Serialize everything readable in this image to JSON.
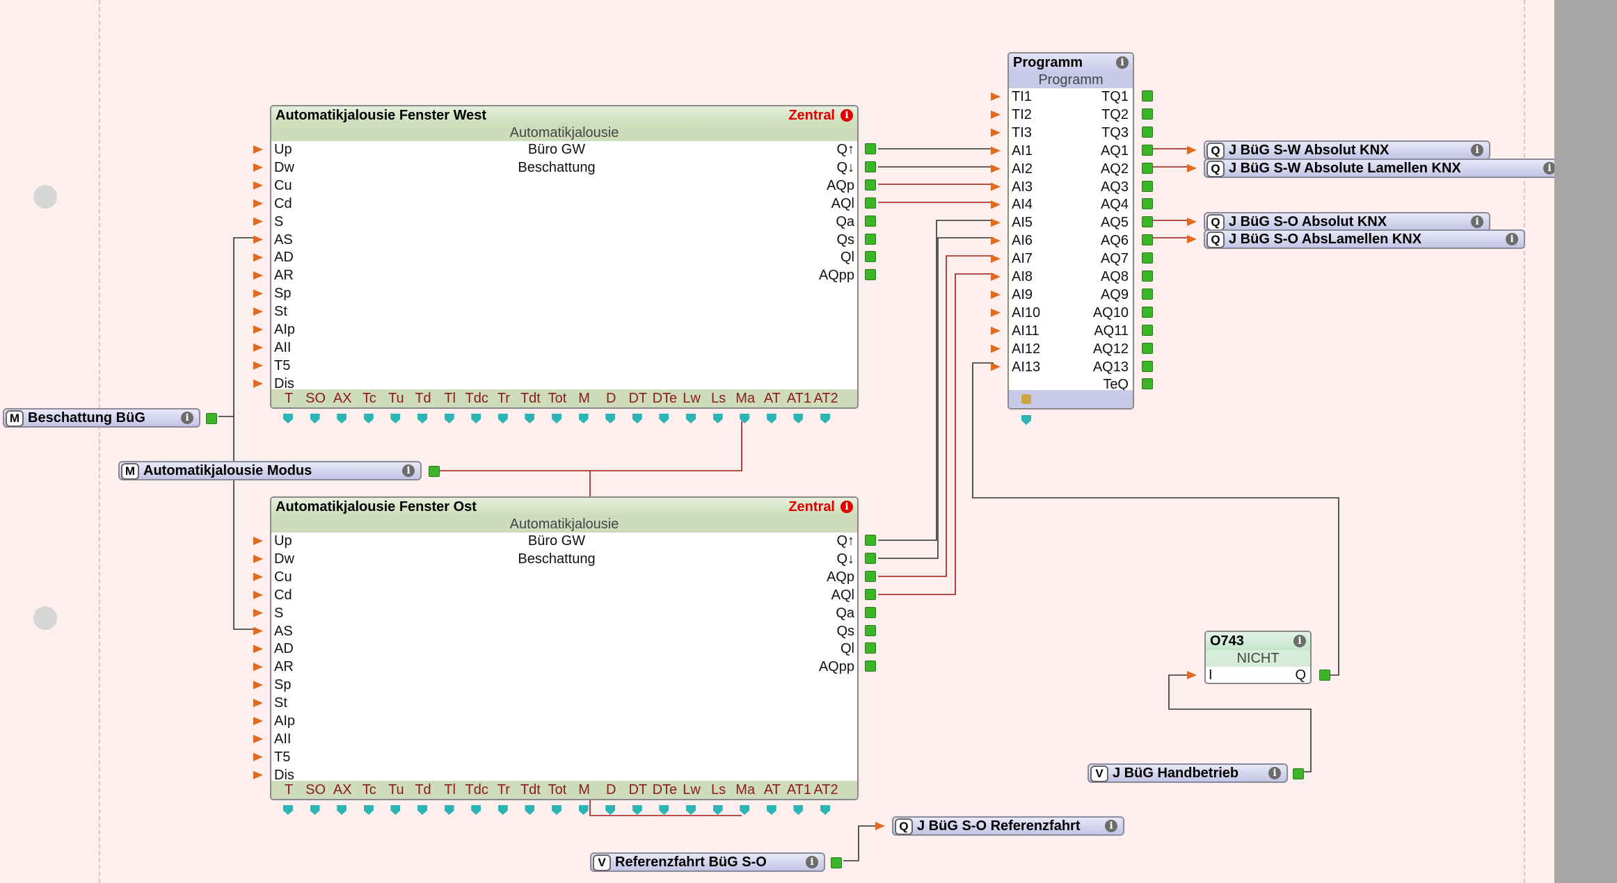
{
  "colors": {
    "background": "#fdefee",
    "wire_red": "#a01818",
    "wire_dark": "#303030",
    "pin_label": "#8b1a1a",
    "zentral": "#e00000"
  },
  "blocks": {
    "west": {
      "title": "Automatikjalousie Fenster West",
      "zentral": "Zentral",
      "subtitle": "Automatikjalousie",
      "comment1": "Büro GW",
      "comment2": "Beschattung"
    },
    "ost": {
      "title": "Automatikjalousie Fenster Ost",
      "zentral": "Zentral",
      "subtitle": "Automatikjalousie",
      "comment1": "Büro GW",
      "comment2": "Beschattung"
    },
    "programm": {
      "title": "Programm",
      "subtitle": "Programm"
    },
    "nicht": {
      "title": "O743",
      "subtitle": "NICHT",
      "input": "I",
      "output": "Q"
    }
  },
  "jal_inputs": [
    "Up",
    "Dw",
    "Cu",
    "Cd",
    "S",
    "AS",
    "AD",
    "AR",
    "Sp",
    "St",
    "AIp",
    "AII",
    "T5",
    "Dis"
  ],
  "jal_outputs": [
    "Q↑",
    "Q↓",
    "AQp",
    "AQl",
    "Qa",
    "Qs",
    "Ql",
    "AQpp"
  ],
  "jal_params": [
    "T",
    "SO",
    "AX",
    "Tc",
    "Tu",
    "Td",
    "Tl",
    "Tdc",
    "Tr",
    "Tdt",
    "Tot",
    "M",
    "D",
    "DT",
    "DTe",
    "Lw",
    "Ls",
    "Ma",
    "AT",
    "AT1",
    "AT2"
  ],
  "prog_inputs": [
    "TI1",
    "TI2",
    "TI3",
    "AI1",
    "AI2",
    "AI3",
    "AI4",
    "AI5",
    "AI6",
    "AI7",
    "AI8",
    "AI9",
    "AI10",
    "AI11",
    "AI12",
    "AI13"
  ],
  "prog_outputs": [
    "TQ1",
    "TQ2",
    "TQ3",
    "AQ1",
    "AQ2",
    "AQ3",
    "AQ4",
    "AQ5",
    "AQ6",
    "AQ7",
    "AQ8",
    "AQ9",
    "AQ10",
    "AQ11",
    "AQ12",
    "AQ13",
    "TeQ"
  ],
  "connectors": [
    {
      "id": "beschattung",
      "badge": "M",
      "label": "Beschattung BüG"
    },
    {
      "id": "modus",
      "badge": "M",
      "label": "Automatikjalousie Modus"
    },
    {
      "id": "sw-absolut",
      "badge": "Q",
      "label": "J BüG S-W Absolut KNX"
    },
    {
      "id": "sw-lamellen",
      "badge": "Q",
      "label": "J BüG S-W Absolute Lamellen KNX"
    },
    {
      "id": "so-absolut",
      "badge": "Q",
      "label": "J BüG S-O Absolut KNX"
    },
    {
      "id": "so-lamellen",
      "badge": "Q",
      "label": "J BüG S-O AbsLamellen KNX"
    },
    {
      "id": "handbetrieb",
      "badge": "V",
      "label": "J BüG Handbetrieb"
    },
    {
      "id": "so-referenz",
      "badge": "Q",
      "label": "J BüG S-O Referenzfahrt"
    },
    {
      "id": "referenzfahrt",
      "badge": "V",
      "label": "Referenzfahrt BüG S-O"
    }
  ]
}
